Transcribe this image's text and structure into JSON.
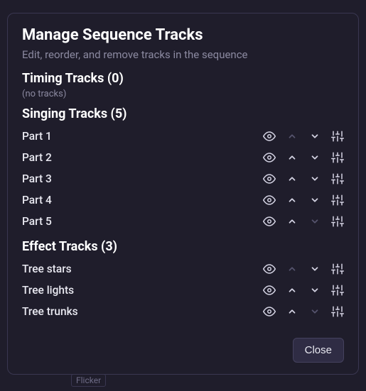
{
  "dialog": {
    "title": "Manage Sequence Tracks",
    "subtitle": "Edit, reorder, and remove tracks in the sequence",
    "close_label": "Close"
  },
  "sections": {
    "timing": {
      "header": "Timing Tracks (0)",
      "empty_text": "(no tracks)"
    },
    "singing": {
      "header": "Singing Tracks (5)",
      "tracks": [
        {
          "name": "Part 1",
          "up_disabled": true,
          "down_disabled": false
        },
        {
          "name": "Part 2",
          "up_disabled": false,
          "down_disabled": false
        },
        {
          "name": "Part 3",
          "up_disabled": false,
          "down_disabled": false
        },
        {
          "name": "Part 4",
          "up_disabled": false,
          "down_disabled": false
        },
        {
          "name": "Part 5",
          "up_disabled": false,
          "down_disabled": true
        }
      ]
    },
    "effect": {
      "header": "Effect Tracks (3)",
      "tracks": [
        {
          "name": "Tree stars",
          "up_disabled": true,
          "down_disabled": false
        },
        {
          "name": "Tree lights",
          "up_disabled": false,
          "down_disabled": false
        },
        {
          "name": "Tree trunks",
          "up_disabled": false,
          "down_disabled": true
        }
      ]
    }
  },
  "background": {
    "hint": "Flicker"
  },
  "icons": {
    "eye": "eye-icon",
    "up": "chevron-up-icon",
    "down": "chevron-down-icon",
    "settings": "sliders-icon"
  }
}
